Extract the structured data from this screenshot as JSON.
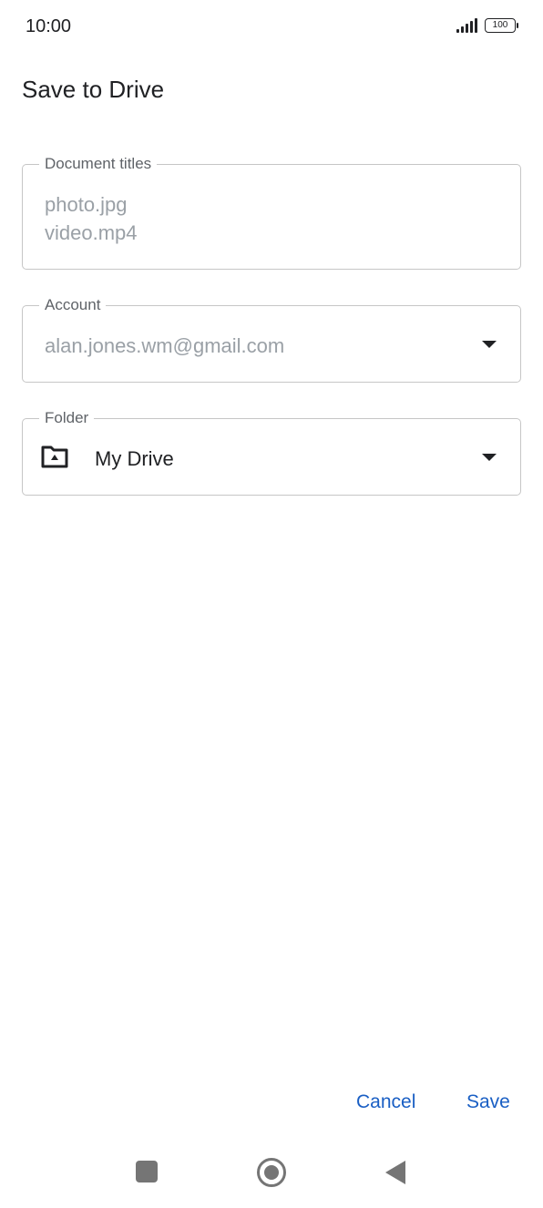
{
  "status_bar": {
    "time": "10:00",
    "battery": "100",
    "signal_icon": "signal-icon",
    "battery_icon": "battery-icon"
  },
  "dialog": {
    "title": "Save to Drive"
  },
  "fields": {
    "document_titles": {
      "label": "Document titles",
      "values": [
        "photo.jpg",
        "video.mp4"
      ]
    },
    "account": {
      "label": "Account",
      "value": "alan.jones.wm@gmail.com",
      "icon": "dropdown-arrow-icon"
    },
    "folder": {
      "label": "Folder",
      "value": "My Drive",
      "icon": "drive-folder-icon"
    }
  },
  "actions": {
    "cancel_label": "Cancel",
    "save_label": "Save"
  },
  "nav_bar": {
    "icons": [
      "recents-icon",
      "home-icon",
      "back-icon"
    ]
  },
  "colors": {
    "accent": "#1a5fc4",
    "border": "#c6c6c6",
    "muted_text": "#9aa0a6"
  }
}
